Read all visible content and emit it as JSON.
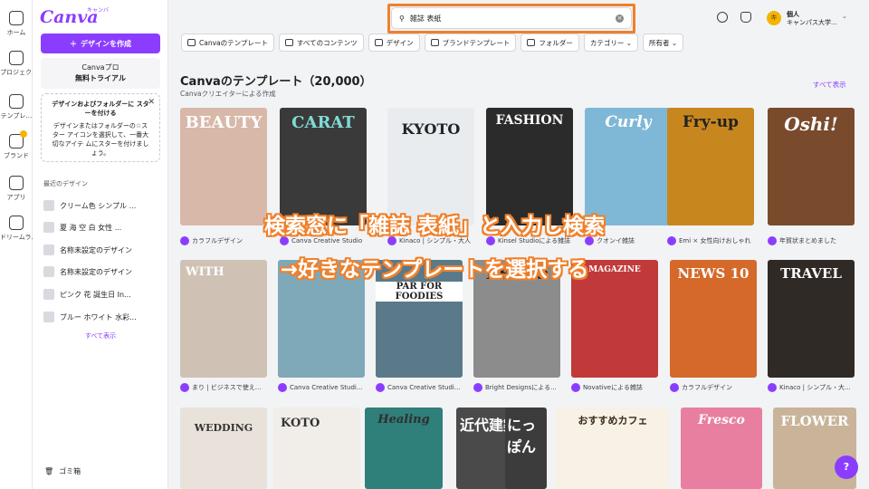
{
  "rail": [
    {
      "label": "ホーム",
      "icon": "home-icon"
    },
    {
      "label": "プロジェク…",
      "icon": "folder-icon"
    },
    {
      "label": "テンプレ…",
      "icon": "template-icon"
    },
    {
      "label": "ブランド",
      "icon": "brand-icon"
    },
    {
      "label": "アプリ",
      "icon": "apps-icon"
    },
    {
      "label": "ドリームラ…",
      "icon": "dream-lab-icon"
    }
  ],
  "logo": {
    "text": "Canva",
    "sub": "キャンバ"
  },
  "panel": {
    "create_label": "デザインを作成",
    "pro_line1": "Canvaプロ",
    "pro_line2": "無料トライアル",
    "tip_title": "デザインおよびフォルダーに スターを付ける",
    "tip_body": "デザインまたはフォルダーの☆スター アイコンを選択して、一番大切なアイテ ムにスターを付けましょう。",
    "recent_title": "最近のデザイン",
    "recent": [
      "クリーム色 シンプル ...",
      "夏 海 空 白 女性 ...",
      "名称未設定のデザイン",
      "名称未設定のデザイン",
      "ピンク 花 誕生日 In...",
      "ブルー ホワイト 水彩..."
    ],
    "show_all": "すべて表示",
    "trash": "ゴミ箱"
  },
  "search": {
    "value": "雑誌 表紙"
  },
  "account": {
    "initial": "キ",
    "line1": "個人",
    "line2": "キャンパス大学..."
  },
  "chips": [
    "Canvaのテンプレート",
    "すべてのコンテンツ",
    "デザイン",
    "ブランドテンプレート",
    "フォルダー",
    "カテゴリー ⌄",
    "所有者 ⌄"
  ],
  "header": {
    "title": "Canvaのテンプレート（20,000）",
    "subtitle": "Canvaクリエイターによる作成",
    "show_all": "すべて表示"
  },
  "row1": [
    {
      "title": "BEAUTY",
      "creator": "カラフルデザイン",
      "color": "#d8b8a8"
    },
    {
      "title": "CARAT",
      "creator": "Canva Creative Studio",
      "color": "#3a3a3a"
    },
    {
      "title": "KYOTO",
      "creator": "Kinaco | シンプル・大人",
      "color": "#e9ecef"
    },
    {
      "title": "FASHION",
      "creator": "Kinsel Studioによる雑誌",
      "color": "#2b2b2b"
    },
    {
      "title": "Curly",
      "creator": "クオンイ雑誌",
      "color": "#7fb8d6"
    },
    {
      "title": "Fry-up",
      "creator": "Emi × 女性向けおしゃれ",
      "color": "#c8871e"
    },
    {
      "title": "Oshi!",
      "creator": "年賀状まとめました",
      "color": "#7a4a2c"
    }
  ],
  "row2": [
    {
      "title": "WITH",
      "creator": "まり | ビジネスで使え...",
      "color": "#cfc2b5"
    },
    {
      "title": "",
      "creator": "Canva Creative Studi...",
      "color": "#7fa8b8"
    },
    {
      "title": "PAR FOR FOODIES",
      "creator": "Canva Creative Studi...",
      "color": "#5a7a8a"
    },
    {
      "title": "RETRO",
      "creator": "Bright Designsによる...",
      "color": "#8c8c8c"
    },
    {
      "title": "MAGAZINE",
      "creator": "Novativeによる雑誌",
      "color": "#c13a3a"
    },
    {
      "title": "NEWS 10",
      "creator": "カラフルデザイン",
      "color": "#d4692a"
    },
    {
      "title": "TRAVEL",
      "creator": "Kinaco | シンプル・大...",
      "color": "#2f2a26"
    }
  ],
  "row3": [
    {
      "title": "WEDDING",
      "color": "#e8e2da"
    },
    {
      "title": "KOTO",
      "color": "#f1ede8"
    },
    {
      "title": "Healing",
      "color": "#2f7f7a"
    },
    {
      "title": "近代建築",
      "color": "#4a4a4a"
    },
    {
      "title": "にっぽん",
      "color": "#3c3c3c"
    },
    {
      "title": "おすすめカフェ",
      "color": "#f7f1e6"
    },
    {
      "title": "Fresco",
      "color": "#e87fa0"
    },
    {
      "title": "FLOWER",
      "color": "#c9b49a"
    }
  ],
  "overlay": {
    "line1": "検索窓に「雑誌 表紙」と入力し検索",
    "line2": "→好きなテンプレートを選択する"
  },
  "help": "?"
}
